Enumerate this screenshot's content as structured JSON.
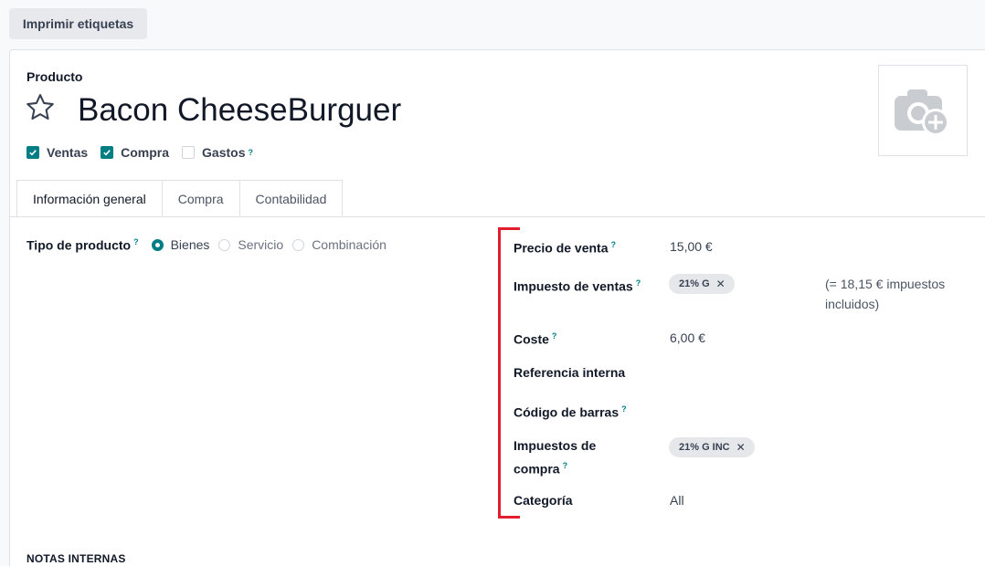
{
  "toolbar": {
    "print_label": "Imprimir etiquetas"
  },
  "product": {
    "section_label": "Producto",
    "name": "Bacon CheeseBurguer",
    "starred": false
  },
  "flags": [
    {
      "label": "Ventas",
      "checked": true
    },
    {
      "label": "Compra",
      "checked": true
    },
    {
      "label": "Gastos",
      "checked": false,
      "help": "?"
    }
  ],
  "tabs": [
    {
      "label": "Información general",
      "active": true
    },
    {
      "label": "Compra",
      "active": false
    },
    {
      "label": "Contabilidad",
      "active": false
    }
  ],
  "product_type": {
    "label": "Tipo de producto",
    "help": "?",
    "options": [
      {
        "label": "Bienes",
        "selected": true
      },
      {
        "label": "Servicio",
        "selected": false
      },
      {
        "label": "Combinación",
        "selected": false
      }
    ]
  },
  "fields": {
    "sale_price": {
      "label": "Precio de venta",
      "help": "?",
      "value": "15,00 €"
    },
    "sales_tax": {
      "label": "Impuesto de ventas",
      "help": "?",
      "tag": "21% G",
      "included": "(= 18,15 € impuestos incluidos)"
    },
    "cost": {
      "label": "Coste",
      "help": "?",
      "value": "6,00 €"
    },
    "internal_ref": {
      "label": "Referencia interna",
      "value": ""
    },
    "barcode": {
      "label": "Código de barras",
      "help": "?",
      "value": ""
    },
    "purchase_tax": {
      "label_line1": "Impuestos de",
      "label_line2": "compra",
      "help": "?",
      "tag": "21% G INC"
    },
    "category": {
      "label": "Categoría",
      "value": "All"
    }
  },
  "notes_heading": "NOTAS INTERNAS",
  "colors": {
    "accent": "#017e84",
    "highlight_bracket": "#e11d2e",
    "tag_bg": "#e5e7eb"
  },
  "icons": {
    "star": "star-outline-icon",
    "photo": "camera-add-icon",
    "tag_remove": "close-icon"
  }
}
